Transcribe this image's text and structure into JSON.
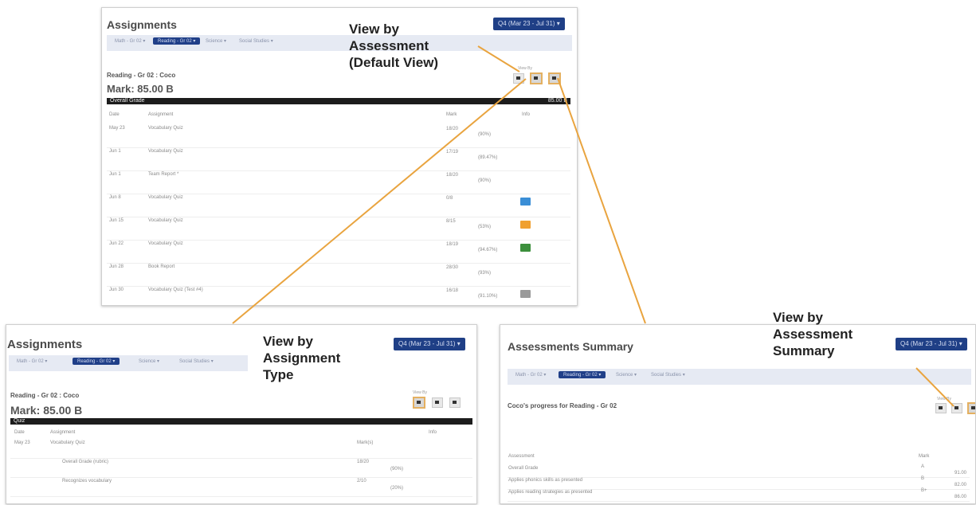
{
  "callouts": {
    "assessment": [
      "View by",
      "Assessment",
      "(Default View)"
    ],
    "type": [
      "View by",
      "Assignment",
      "Type"
    ],
    "summary": [
      "View by",
      "Assessment",
      "Summary"
    ]
  },
  "top": {
    "title": "Assignments",
    "term": "Q4 (Mar 23 - Jul 31) ▾",
    "tabs": [
      "Math - Gr 02 ▾",
      "Reading - Gr 02 ▾",
      "Science ▾",
      "Social Studies ▾"
    ],
    "course": "Reading - Gr 02 : Coco",
    "view_by": "View By",
    "mark": "Mark: 85.00 B",
    "grade_bar_label": "Overall Grade",
    "grade_bar_value": "85.00 B",
    "headers": {
      "date": "Date",
      "assignment": "Assignment",
      "mark": "Mark",
      "info": "Info"
    },
    "rows": [
      {
        "date": "May 23",
        "assignment": "Vocabulary Quiz",
        "mark": "18/20",
        "pct": "(90%)",
        "badge": ""
      },
      {
        "date": "Jun 1",
        "assignment": "Vocabulary Quiz",
        "mark": "17/19",
        "pct": "(89.47%)",
        "badge": ""
      },
      {
        "date": "Jun 1",
        "assignment": "Team Report *",
        "mark": "18/20",
        "pct": "(90%)",
        "badge": ""
      },
      {
        "date": "Jun 8",
        "assignment": "Vocabulary Quiz",
        "mark": "0/8",
        "pct": "",
        "badge": "#3a8ed6"
      },
      {
        "date": "Jun 15",
        "assignment": "Vocabulary Quiz",
        "mark": "8/15",
        "pct": "(53%)",
        "badge": "#f0a030"
      },
      {
        "date": "Jun 22",
        "assignment": "Vocabulary Quiz",
        "mark": "18/19",
        "pct": "(94.67%)",
        "badge": "#3c8f3c"
      },
      {
        "date": "Jun 28",
        "assignment": "Book Report",
        "mark": "28/30",
        "pct": "(93%)",
        "badge": ""
      },
      {
        "date": "Jun 30",
        "assignment": "Vocabulary Quiz (Test #4)",
        "mark": "16/18",
        "pct": "(91.10%)",
        "badge": "#9a9a9a"
      }
    ]
  },
  "left": {
    "title": "Assignments",
    "term": "Q4 (Mar 23 - Jul 31) ▾",
    "tabs": [
      "Math - Gr 02 ▾",
      "Reading - Gr 02 ▾",
      "Science ▾",
      "Social Studies ▾"
    ],
    "course": "Reading - Gr 02 : Coco",
    "view_by": "View By",
    "mark": "Mark: 85.00 B",
    "grade_bar_label": "Quiz",
    "headers": {
      "date": "Date",
      "assignment": "Assignment",
      "info": "Info"
    },
    "rows": [
      {
        "date": "May 23",
        "assignment": "Vocabulary Quiz",
        "mark": "Mark(s)",
        "pct": ""
      },
      {
        "date": "",
        "assignment": "Overall Grade (rubric)",
        "mark": "18/20",
        "pct": "(90%)"
      },
      {
        "date": "",
        "assignment": "Recognizes vocabulary",
        "mark": "2/10",
        "pct": "(20%)"
      }
    ]
  },
  "right": {
    "title": "Assessments Summary",
    "term": "Q4 (Mar 23 - Jul 31) ▾",
    "tabs": [
      "Math - Gr 02 ▾",
      "Reading - Gr 02 ▾",
      "Science ▾",
      "Social Studies ▾"
    ],
    "progress": "Coco's progress for Reading - Gr 02",
    "view_by": "View By",
    "headers": {
      "assessment": "Assessment",
      "mark": "Mark"
    },
    "rows": [
      {
        "assessment": "Overall Grade",
        "mark": "A",
        "score": "91.00"
      },
      {
        "assessment": "Applies phonics skills as presented",
        "mark": "B",
        "score": "82.00"
      },
      {
        "assessment": "Applies reading strategies as presented",
        "mark": "B+",
        "score": "86.00"
      }
    ]
  },
  "colors": {
    "accent": "#1f3f86",
    "highlight": "#e4b060",
    "connector": "#e9a43f"
  }
}
